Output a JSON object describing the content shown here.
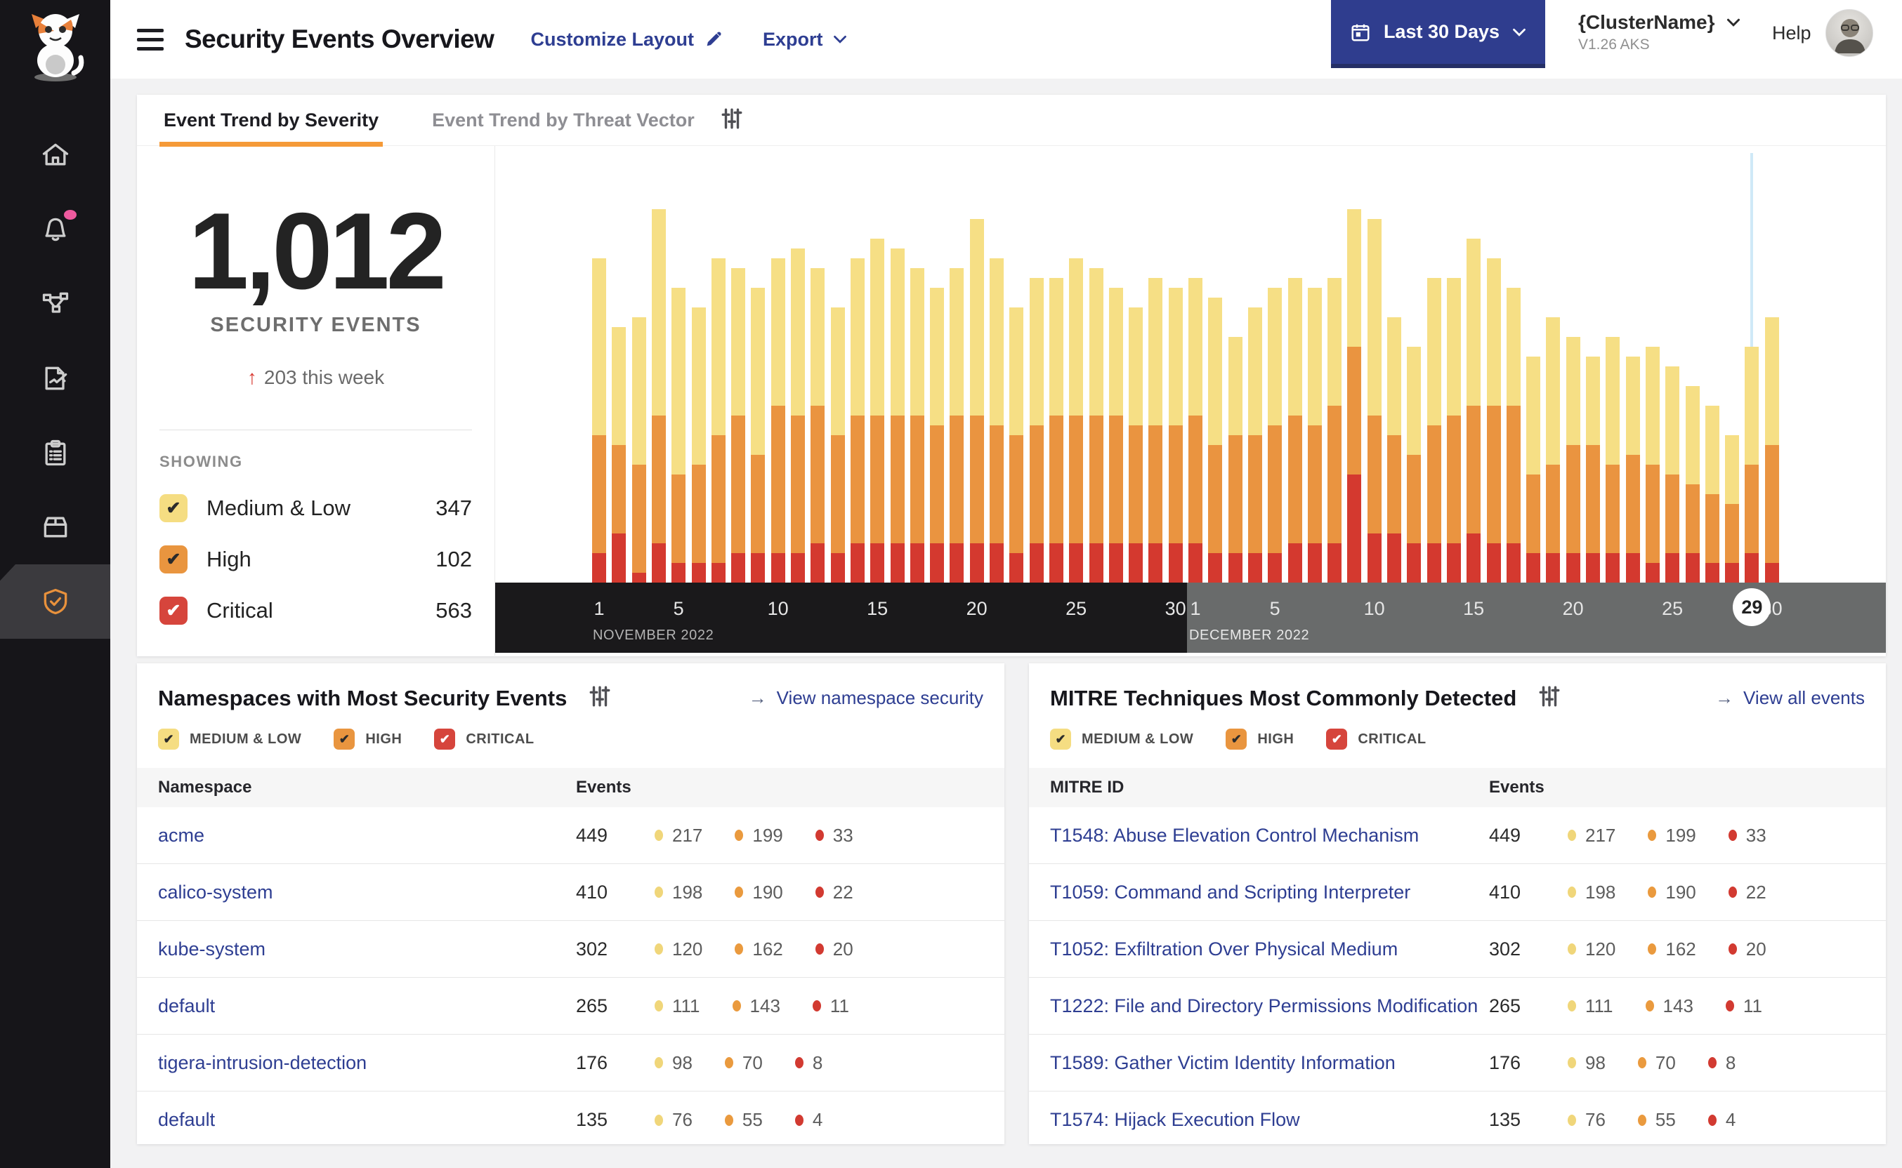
{
  "header": {
    "title": "Security Events Overview",
    "customize_layout": "Customize Layout",
    "export_label": "Export",
    "date_range": "Last 30 Days",
    "cluster_name": "{ClusterName}",
    "cluster_version": "V1.26 AKS",
    "help_label": "Help"
  },
  "sidebar": {
    "icons": [
      "cat-logo",
      "home",
      "alerts-bell",
      "service-graph",
      "policy-edit",
      "compliance-clipboard",
      "workloads-box",
      "threat-defense-shield"
    ],
    "active_item": "threat-defense-shield",
    "alert_badge_color": "#ee5a9e"
  },
  "tabs": {
    "items": [
      {
        "label": "Event Trend by Severity",
        "active": true
      },
      {
        "label": "Event Trend by Threat Vector",
        "active": false
      }
    ]
  },
  "summary": {
    "total": "1,012",
    "label": "SECURITY EVENTS",
    "delta_arrow": "↑",
    "delta": "203 this week",
    "showing_label": "SHOWING",
    "filters": [
      {
        "label": "Medium & Low",
        "count": "347",
        "severity": "medium_low",
        "checked": true
      },
      {
        "label": "High",
        "count": "102",
        "severity": "high",
        "checked": true
      },
      {
        "label": "Critical",
        "count": "563",
        "severity": "critical",
        "checked": true
      }
    ]
  },
  "severity": {
    "medium_low": {
      "box": "#f5dd82",
      "dot": "#f0d67a",
      "check": "#2b2b2b"
    },
    "high": {
      "box": "#e9953f",
      "dot": "#ea9a3e",
      "check": "#2b2b2b"
    },
    "critical": {
      "box": "#d6453c",
      "dot": "#d23a31",
      "check": "#ffffff"
    }
  },
  "chart_data": {
    "type": "bar",
    "stacked": true,
    "title": "Event Trend by Severity",
    "xlabel": "date",
    "ylabel": "security events (y-axis not shown)",
    "grid": false,
    "legend_position": "left-panel-checkboxes",
    "categories": [
      "Nov 1",
      "Nov 2",
      "Nov 3",
      "Nov 4",
      "Nov 5",
      "Nov 6",
      "Nov 7",
      "Nov 8",
      "Nov 9",
      "Nov 10",
      "Nov 11",
      "Nov 12",
      "Nov 13",
      "Nov 14",
      "Nov 15",
      "Nov 16",
      "Nov 17",
      "Nov 18",
      "Nov 19",
      "Nov 20",
      "Nov 21",
      "Nov 22",
      "Nov 23",
      "Nov 24",
      "Nov 25",
      "Nov 26",
      "Nov 27",
      "Nov 28",
      "Nov 29",
      "Nov 30",
      "Dec 1",
      "Dec 2",
      "Dec 3",
      "Dec 4",
      "Dec 5",
      "Dec 6",
      "Dec 7",
      "Dec 8",
      "Dec 9",
      "Dec 10",
      "Dec 11",
      "Dec 12",
      "Dec 13",
      "Dec 14",
      "Dec 15",
      "Dec 16",
      "Dec 17",
      "Dec 18",
      "Dec 19",
      "Dec 20",
      "Dec 21",
      "Dec 22",
      "Dec 23",
      "Dec 24",
      "Dec 25",
      "Dec 26",
      "Dec 27",
      "Dec 28",
      "Dec 29",
      "Dec 30"
    ],
    "series": [
      {
        "name": "Medium & Low",
        "color": "#f6df85",
        "values": [
          18,
          12,
          15,
          21,
          19,
          16,
          18,
          15,
          17,
          15,
          17,
          14,
          13,
          16,
          18,
          17,
          15,
          14,
          15,
          20,
          17,
          13,
          15,
          14,
          16,
          15,
          13,
          12,
          15,
          14,
          14,
          15,
          10,
          13,
          14,
          14,
          14,
          13,
          14,
          20,
          12,
          11,
          15,
          14,
          17,
          15,
          12,
          12,
          15,
          11,
          9,
          13,
          10,
          12,
          11,
          10,
          9,
          7,
          12,
          13
        ]
      },
      {
        "name": "High",
        "color": "#ea9440",
        "values": [
          12,
          9,
          11,
          13,
          9,
          10,
          13,
          14,
          10,
          15,
          14,
          14,
          12,
          13,
          13,
          13,
          13,
          12,
          13,
          13,
          12,
          12,
          12,
          13,
          13,
          13,
          13,
          12,
          12,
          12,
          13,
          11,
          12,
          12,
          13,
          13,
          12,
          14,
          13,
          12,
          10,
          9,
          12,
          13,
          13,
          14,
          14,
          8,
          9,
          11,
          11,
          9,
          10,
          10,
          8,
          7,
          7,
          6,
          9,
          12
        ]
      },
      {
        "name": "Critical",
        "color": "#d4392f",
        "values": [
          3,
          5,
          1,
          4,
          2,
          2,
          2,
          3,
          3,
          3,
          3,
          4,
          3,
          4,
          4,
          4,
          4,
          4,
          4,
          4,
          4,
          3,
          4,
          4,
          4,
          4,
          4,
          4,
          4,
          4,
          4,
          3,
          3,
          3,
          3,
          4,
          4,
          4,
          11,
          5,
          5,
          4,
          4,
          4,
          5,
          4,
          4,
          3,
          3,
          3,
          3,
          3,
          3,
          2,
          3,
          3,
          2,
          2,
          3,
          2
        ]
      }
    ],
    "values_note": "per-day values estimated from bar heights; no y-axis labels shown",
    "months": [
      {
        "label": "NOVEMBER 2022",
        "days": 30,
        "ticks": [
          1,
          5,
          10,
          15,
          20,
          25,
          30
        ]
      },
      {
        "label": "DECEMBER 2022",
        "days": 30,
        "ticks": [
          1,
          5,
          10,
          15,
          20,
          25,
          30
        ],
        "highlighted_day": 29
      }
    ]
  },
  "namespaces_card": {
    "title": "Namespaces with Most Security Events",
    "link": "View namespace security",
    "filters": [
      {
        "label": "MEDIUM & LOW",
        "severity": "medium_low"
      },
      {
        "label": "HIGH",
        "severity": "high"
      },
      {
        "label": "CRITICAL",
        "severity": "critical"
      }
    ],
    "columns": [
      "Namespace",
      "Events"
    ],
    "rows": [
      {
        "name": "acme",
        "total": "449",
        "medium_low": "217",
        "high": "199",
        "critical": "33"
      },
      {
        "name": "calico-system",
        "total": "410",
        "medium_low": "198",
        "high": "190",
        "critical": "22"
      },
      {
        "name": "kube-system",
        "total": "302",
        "medium_low": "120",
        "high": "162",
        "critical": "20"
      },
      {
        "name": "default",
        "total": "265",
        "medium_low": "111",
        "high": "143",
        "critical": "11"
      },
      {
        "name": "tigera-intrusion-detection",
        "total": "176",
        "medium_low": "98",
        "high": "70",
        "critical": "8"
      },
      {
        "name": "default",
        "total": "135",
        "medium_low": "76",
        "high": "55",
        "critical": "4"
      }
    ]
  },
  "mitre_card": {
    "title": "MITRE Techniques Most Commonly Detected",
    "link": "View all events",
    "filters": [
      {
        "label": "MEDIUM & LOW",
        "severity": "medium_low"
      },
      {
        "label": "HIGH",
        "severity": "high"
      },
      {
        "label": "CRITICAL",
        "severity": "critical"
      }
    ],
    "columns": [
      "MITRE ID",
      "Events"
    ],
    "rows": [
      {
        "name": "T1548: Abuse Elevation Control Mechanism",
        "total": "449",
        "medium_low": "217",
        "high": "199",
        "critical": "33"
      },
      {
        "name": "T1059: Command and Scripting Interpreter",
        "total": "410",
        "medium_low": "198",
        "high": "190",
        "critical": "22"
      },
      {
        "name": "T1052: Exfiltration Over Physical Medium",
        "total": "302",
        "medium_low": "120",
        "high": "162",
        "critical": "20"
      },
      {
        "name": "T1222: File and Directory Permissions Modification",
        "total": "265",
        "medium_low": "111",
        "high": "143",
        "critical": "11"
      },
      {
        "name": "T1589: Gather Victim Identity Information",
        "total": "176",
        "medium_low": "98",
        "high": "70",
        "critical": "8"
      },
      {
        "name": "T1574: Hijack Execution Flow",
        "total": "135",
        "medium_low": "76",
        "high": "55",
        "critical": "4"
      }
    ]
  }
}
